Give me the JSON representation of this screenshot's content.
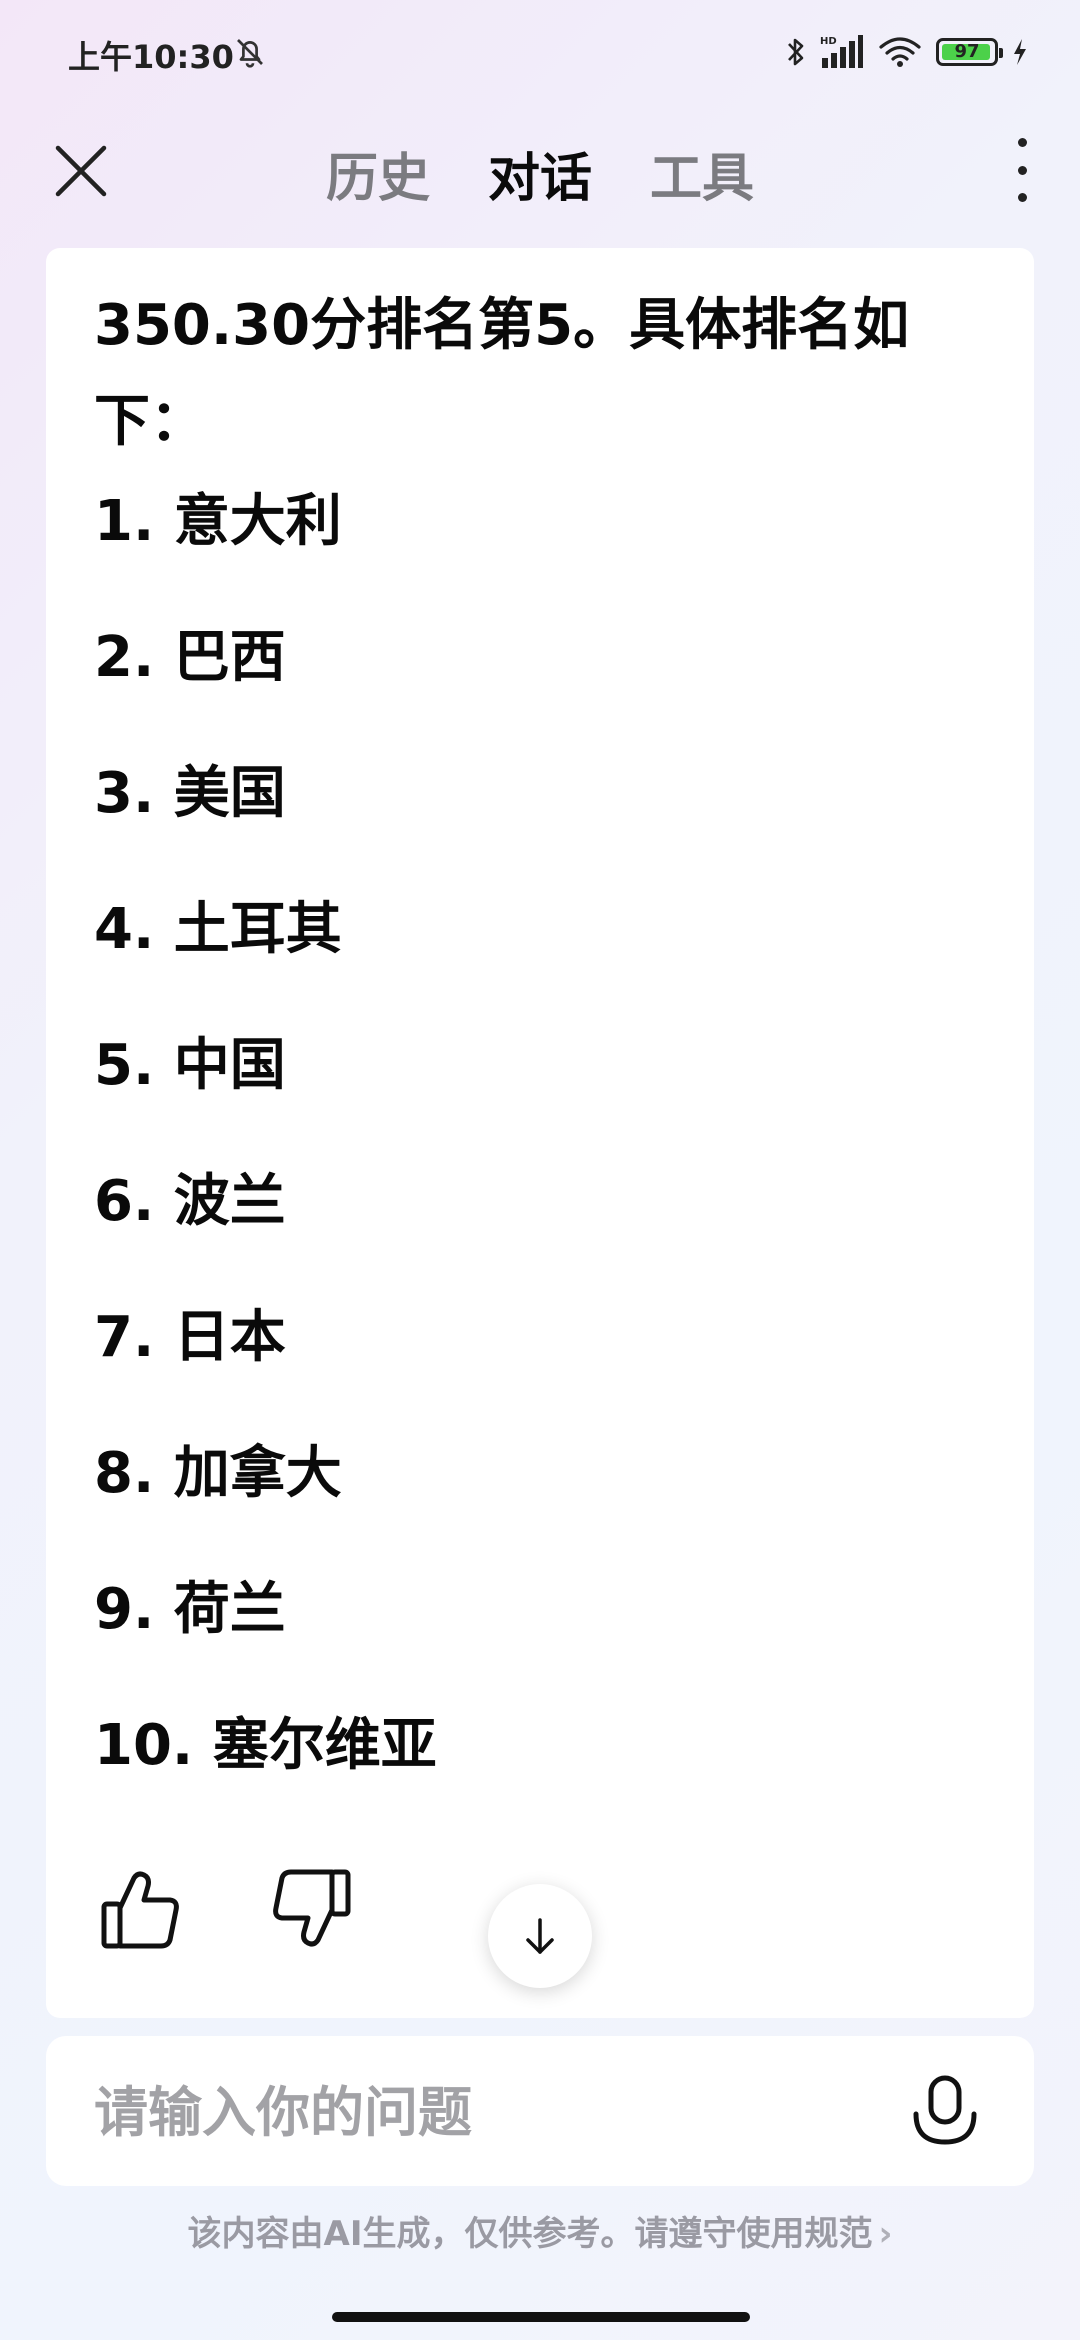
{
  "status_bar": {
    "time": "上午10:30",
    "battery": "97",
    "battery_level": 0.97,
    "icons": [
      "mute-bell-icon",
      "bluetooth-icon",
      "hd-signal-icon",
      "wifi-icon",
      "battery-icon",
      "charging-icon"
    ]
  },
  "header": {
    "tabs": [
      {
        "label": "历史",
        "active": false
      },
      {
        "label": "对话",
        "active": true
      },
      {
        "label": "工具",
        "active": false
      }
    ]
  },
  "message": {
    "intro": "350.30分排名第5。具体排名如下：",
    "items": [
      "1. 意大利",
      "2. 巴西",
      "3. 美国",
      "4. 土耳其",
      "5. 中国",
      "6. 波兰",
      "7. 日本",
      "8. 加拿大",
      "9. 荷兰",
      "10. 塞尔维亚"
    ]
  },
  "input": {
    "placeholder": "请输入你的问题"
  },
  "footer": {
    "disclaimer": "该内容由AI生成，仅供参考。请遵守使用规范",
    "chevron": "›"
  },
  "colors": {
    "tab_active": "#0b0b0b",
    "tab_inactive": "#7b7b80",
    "battery_fill": "#4cd14a",
    "placeholder": "#a2a2a6"
  }
}
